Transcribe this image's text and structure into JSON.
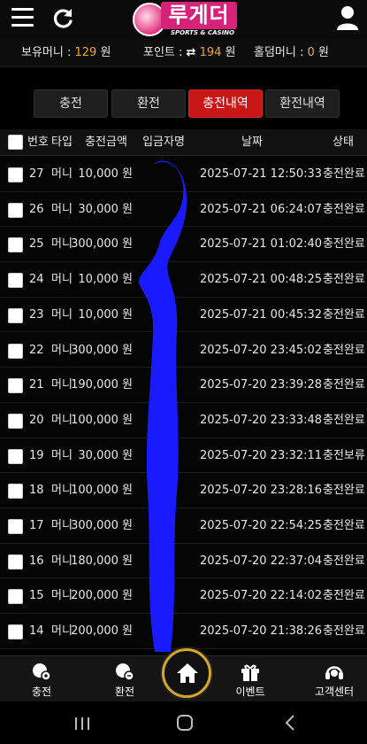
{
  "logo": {
    "text": "루게더",
    "subtitle": "SPORTS & CASINO"
  },
  "balance": {
    "money_label": "보유머니 : ",
    "money_value": "129",
    "money_unit": " 원",
    "point_label": "포인트 : ",
    "point_swap": "⇄",
    "point_value": "194",
    "point_unit": " 원",
    "holdem_label": "홀덤머니 : ",
    "holdem_value": "0",
    "holdem_unit": " 원"
  },
  "tabs": [
    {
      "label": "충전",
      "active": false
    },
    {
      "label": "환전",
      "active": false
    },
    {
      "label": "충전내역",
      "active": true
    },
    {
      "label": "환전내역",
      "active": false
    }
  ],
  "table": {
    "headers": {
      "no": "번호",
      "type": "타입",
      "amount": "충전금액",
      "depositor": "입금자명",
      "date": "날짜",
      "status": "상태"
    },
    "rows": [
      {
        "no": "27",
        "type": "머니",
        "amount": "10,000 원",
        "date": "2025-07-21 12:50:33",
        "status": "충전완료"
      },
      {
        "no": "26",
        "type": "머니",
        "amount": "30,000 원",
        "date": "2025-07-21 06:24:07",
        "status": "충전완료"
      },
      {
        "no": "25",
        "type": "머니",
        "amount": "300,000 원",
        "date": "2025-07-21 01:02:40",
        "status": "충전완료"
      },
      {
        "no": "24",
        "type": "머니",
        "amount": "10,000 원",
        "date": "2025-07-21 00:48:25",
        "status": "충전완료"
      },
      {
        "no": "23",
        "type": "머니",
        "amount": "10,000 원",
        "date": "2025-07-21 00:45:32",
        "status": "충전완료"
      },
      {
        "no": "22",
        "type": "머니",
        "amount": "300,000 원",
        "date": "2025-07-20 23:45:02",
        "status": "충전완료"
      },
      {
        "no": "21",
        "type": "머니",
        "amount": "190,000 원",
        "date": "2025-07-20 23:39:28",
        "status": "충전완료"
      },
      {
        "no": "20",
        "type": "머니",
        "amount": "100,000 원",
        "date": "2025-07-20 23:33:48",
        "status": "충전완료"
      },
      {
        "no": "19",
        "type": "머니",
        "amount": "30,000 원",
        "date": "2025-07-20 23:32:11",
        "status": "충전보류"
      },
      {
        "no": "18",
        "type": "머니",
        "amount": "100,000 원",
        "date": "2025-07-20 23:28:16",
        "status": "충전완료"
      },
      {
        "no": "17",
        "type": "머니",
        "amount": "300,000 원",
        "date": "2025-07-20 22:54:25",
        "status": "충전완료"
      },
      {
        "no": "16",
        "type": "머니",
        "amount": "180,000 원",
        "date": "2025-07-20 22:37:04",
        "status": "충전완료"
      },
      {
        "no": "15",
        "type": "머니",
        "amount": "200,000 원",
        "date": "2025-07-20 22:14:02",
        "status": "충전완료"
      },
      {
        "no": "14",
        "type": "머니",
        "amount": "200,000 원",
        "date": "2025-07-20 21:38:26",
        "status": "충전완료"
      }
    ]
  },
  "bottom_nav": {
    "charge": "충전",
    "exchange": "환전",
    "event": "이벤트",
    "support": "고객센터"
  },
  "colors": {
    "accent": "#f0a92c",
    "active_tab": "#c91717",
    "redaction": "#1a1aff"
  }
}
